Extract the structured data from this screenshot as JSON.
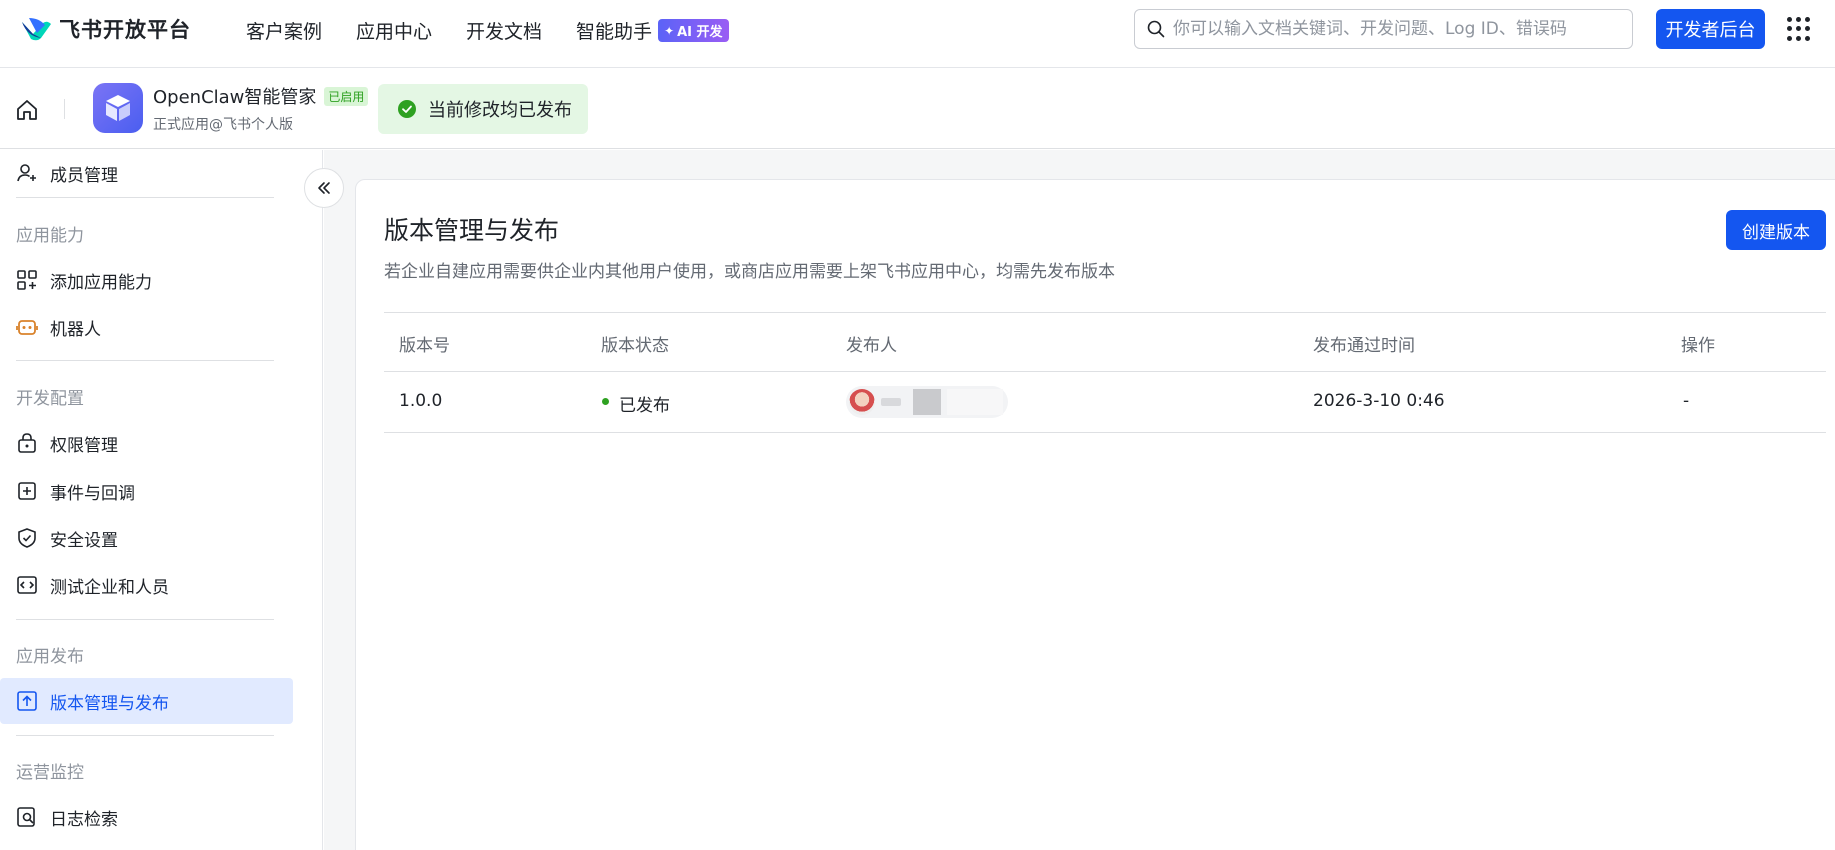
{
  "brand": {
    "name": "飞书开放平台",
    "color": "#1456f0"
  },
  "topnav": {
    "items": [
      "客户案例",
      "应用中心",
      "开发文档",
      "智能助手"
    ],
    "ai_badge": "AI 开发"
  },
  "search": {
    "placeholder": "你可以输入文档关键词、开发问题、Log ID、错误码",
    "value": ""
  },
  "dev_console_button": "开发者后台",
  "app": {
    "name": "OpenClaw智能管家",
    "status_badge": "已启用",
    "subtitle": "正式应用@飞书个人版",
    "publish_status": "当前修改均已发布"
  },
  "sidebar": {
    "top_item": {
      "label": "成员管理",
      "icon": "add-user-icon"
    },
    "groups": [
      {
        "title": "应用能力",
        "items": [
          {
            "label": "添加应用能力",
            "icon": "apps-add-icon"
          },
          {
            "label": "机器人",
            "icon": "robot-icon"
          }
        ]
      },
      {
        "title": "开发配置",
        "items": [
          {
            "label": "权限管理",
            "icon": "lock-icon"
          },
          {
            "label": "事件与回调",
            "icon": "event-icon"
          },
          {
            "label": "安全设置",
            "icon": "shield-icon"
          },
          {
            "label": "测试企业和人员",
            "icon": "code-icon"
          }
        ]
      },
      {
        "title": "应用发布",
        "items": [
          {
            "label": "版本管理与发布",
            "icon": "upload-icon",
            "active": true
          }
        ]
      },
      {
        "title": "运营监控",
        "items": [
          {
            "label": "日志检索",
            "icon": "log-search-icon"
          }
        ]
      }
    ]
  },
  "main": {
    "title": "版本管理与发布",
    "description": "若企业自建应用需要供企业内其他用户使用，或商店应用需要上架飞书应用中心，均需先发布版本",
    "create_button": "创建版本",
    "table": {
      "headers": [
        "版本号",
        "版本状态",
        "发布人",
        "发布通过时间",
        "操作"
      ],
      "rows": [
        {
          "version": "1.0.0",
          "status": "已发布",
          "publisher": "",
          "time": "2026-3-10 0:46",
          "action": "-"
        }
      ]
    }
  },
  "colors": {
    "primary": "#1456f0",
    "success": "#2ea121",
    "active_bg": "#e1eaff"
  }
}
